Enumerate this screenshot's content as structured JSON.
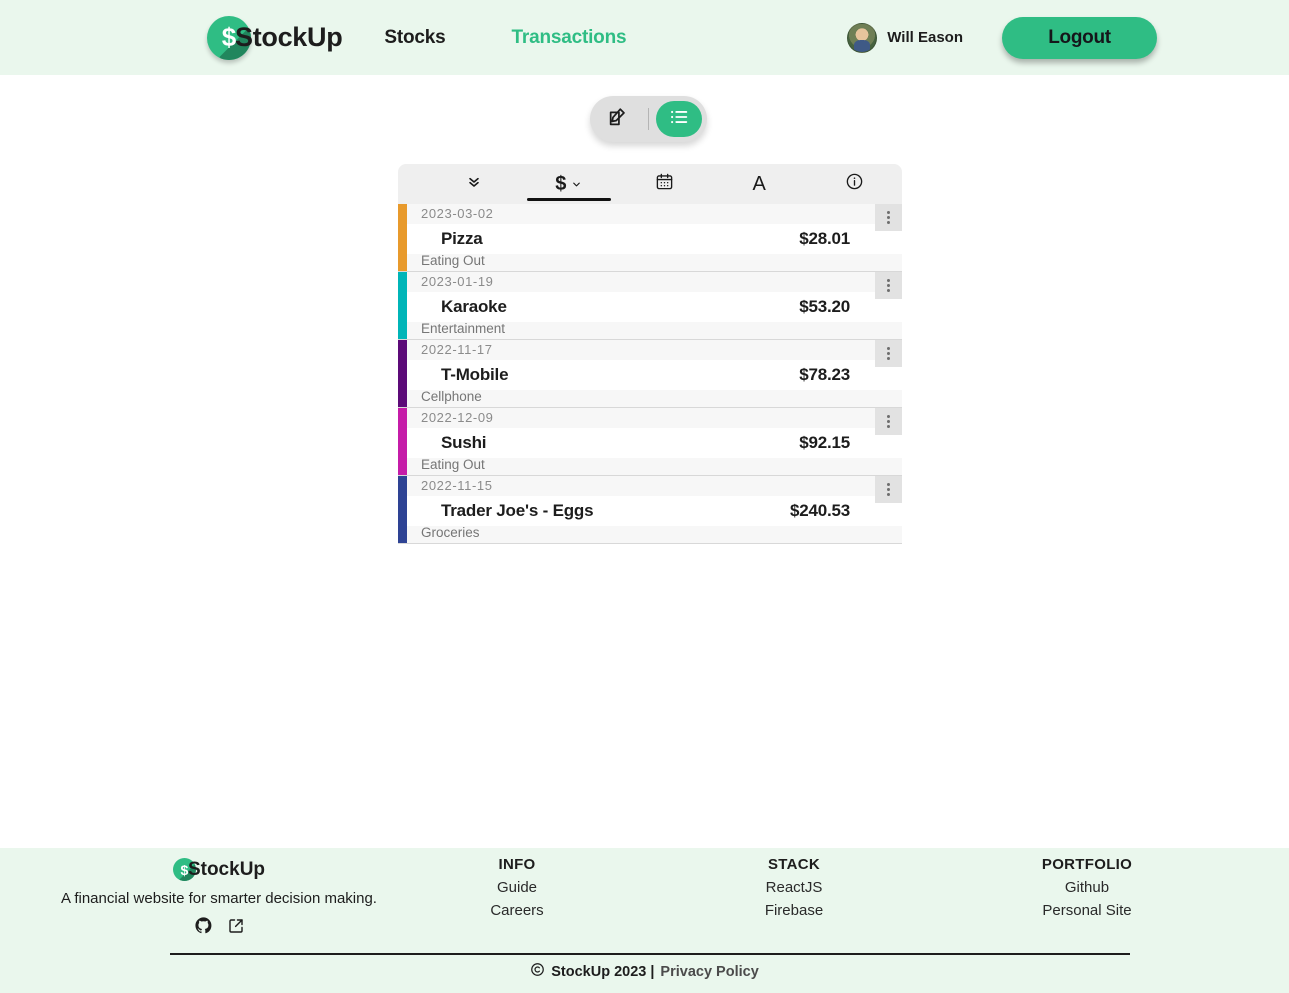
{
  "header": {
    "brand_name": "StockUp",
    "logo_icon": "dollar-circle-icon",
    "nav": [
      {
        "label": "Stocks",
        "active": false
      },
      {
        "label": "Transactions",
        "active": true
      }
    ],
    "user_name": "Will Eason",
    "avatar_icon": "user-avatar",
    "logout_label": "Logout",
    "accent_color": "#2fbd84",
    "background_color": "#eaf7ed"
  },
  "view_toggle": {
    "options": [
      {
        "icon": "edit-square-icon",
        "active": false
      },
      {
        "icon": "list-icon",
        "active": true
      }
    ],
    "active_color": "#2fbd84"
  },
  "panel": {
    "tabs": [
      {
        "icon": "double-chevron-down-icon",
        "label": "",
        "active": false
      },
      {
        "icon": "dollar-sort-icon",
        "label": "$",
        "active": true
      },
      {
        "icon": "calendar-icon",
        "label": "",
        "active": false
      },
      {
        "icon": "letter-a-icon",
        "label": "A",
        "active": false
      },
      {
        "icon": "info-circle-icon",
        "label": "",
        "active": false
      }
    ],
    "transactions": [
      {
        "date": "2023-03-02",
        "name": "Pizza",
        "amount": "$28.01",
        "category": "Eating Out",
        "color": "#e89a2c"
      },
      {
        "date": "2023-01-19",
        "name": "Karaoke",
        "amount": "$53.20",
        "category": "Entertainment",
        "color": "#00b5b8"
      },
      {
        "date": "2022-11-17",
        "name": "T-Mobile",
        "amount": "$78.23",
        "category": "Cellphone",
        "color": "#5c0a78"
      },
      {
        "date": "2022-12-09",
        "name": "Sushi",
        "amount": "$92.15",
        "category": "Eating Out",
        "color": "#c51ca8"
      },
      {
        "date": "2022-11-15",
        "name": "Trader Joe's - Eggs",
        "amount": "$240.53",
        "category": "Groceries",
        "color": "#2e4394"
      }
    ],
    "row_menu_icon": "kebab-menu-icon"
  },
  "footer": {
    "brand_name": "StockUp",
    "tagline": "A financial website for smarter decision making.",
    "social": [
      {
        "icon": "github-icon"
      },
      {
        "icon": "external-link-icon"
      }
    ],
    "columns": [
      {
        "title": "INFO",
        "links": [
          "Guide",
          "Careers"
        ]
      },
      {
        "title": "STACK",
        "links": [
          "ReactJS",
          "Firebase"
        ]
      },
      {
        "title": "PORTFOLIO",
        "links": [
          "Github",
          "Personal Site"
        ]
      }
    ],
    "copyright": "StockUp 2023 |",
    "copyright_icon": "copyright-icon",
    "privacy_label": "Privacy Policy"
  }
}
